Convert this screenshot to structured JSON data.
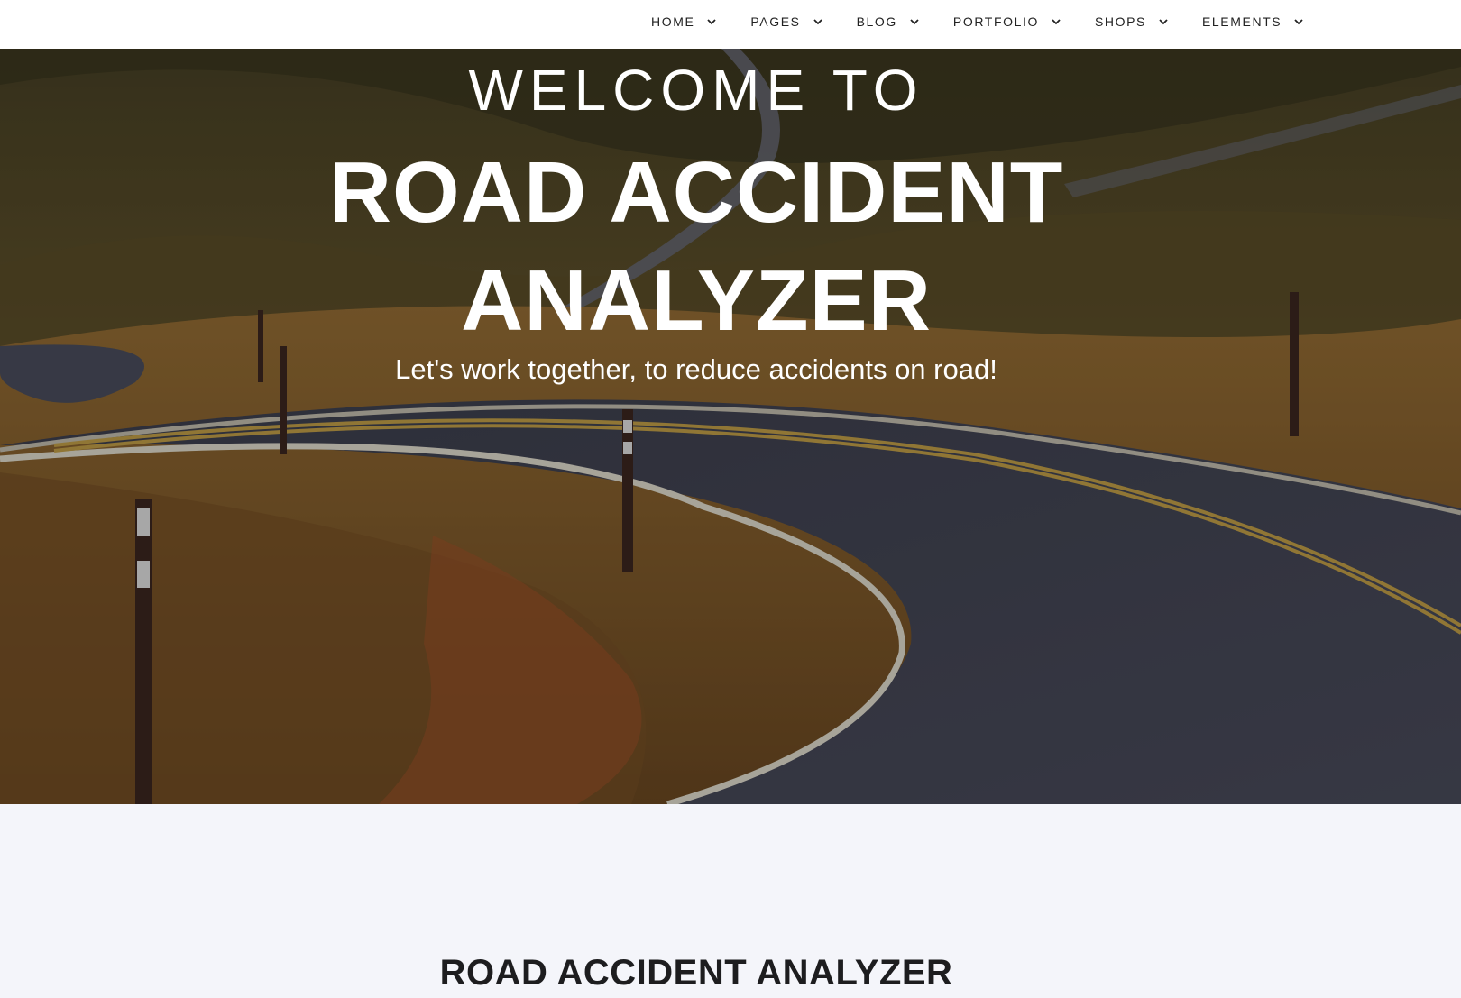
{
  "nav": {
    "items": [
      {
        "label": "HOME"
      },
      {
        "label": "PAGES"
      },
      {
        "label": "BLOG"
      },
      {
        "label": "PORTFOLIO"
      },
      {
        "label": "SHOPS"
      },
      {
        "label": "ELEMENTS"
      }
    ]
  },
  "hero": {
    "welcome": "WELCOME TO",
    "title_line1": "ROAD ACCIDENT",
    "title_line2": "ANALYZER",
    "tagline": "Let's work together, to reduce accidents on road!"
  },
  "section": {
    "title": "ROAD ACCIDENT ANALYZER"
  },
  "colors": {
    "nav_bg": "#ffffff",
    "nav_text": "#222222",
    "hero_text": "#ffffff",
    "section_bg": "#f4f5fa",
    "section_title": "#1d1d1f"
  }
}
